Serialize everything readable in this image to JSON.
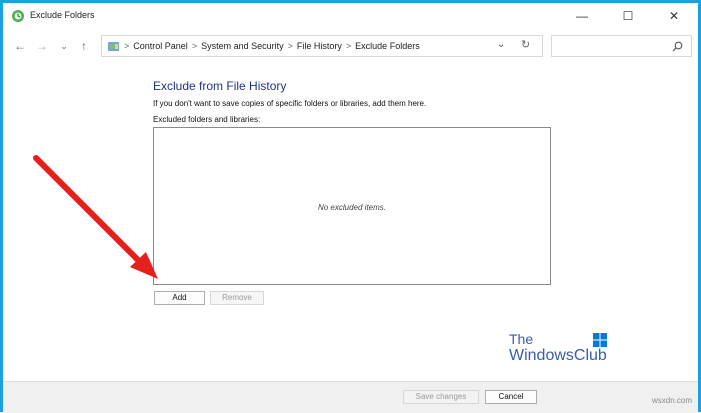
{
  "window": {
    "title": "Exclude Folders",
    "minimize_glyph": "—",
    "maximize_glyph": "☐",
    "close_glyph": "✕"
  },
  "nav": {
    "back_glyph": "←",
    "forward_glyph": "→",
    "recent_glyph": "⌄",
    "up_glyph": "↑",
    "breadcrumb_sep": ">",
    "breadcrumbs": [
      "Control Panel",
      "System and Security",
      "File History",
      "Exclude Folders"
    ],
    "dropdown_glyph": "⌄",
    "refresh_glyph": "↻",
    "search_placeholder": ""
  },
  "main": {
    "heading": "Exclude from File History",
    "description": "If you don't want to save copies of specific folders or libraries, add them here.",
    "list_label": "Excluded folders and libraries:",
    "empty_text": "No excluded items.",
    "add_label": "Add",
    "remove_label": "Remove"
  },
  "footer": {
    "save_label": "Save changes",
    "cancel_label": "Cancel"
  },
  "branding": {
    "logo_line1": "The",
    "logo_line2": "WindowsClub",
    "watermark": "wsxdn.com"
  },
  "colors": {
    "frame_border": "#1ba1e2",
    "heading": "#1e3287",
    "arrow": "#e3201b",
    "logo_text": "#3a5da8",
    "win_logo": "#0a78d7"
  },
  "icons": {
    "app": "file-history-icon",
    "address": "control-panel-icon",
    "search": "search-icon",
    "arrow": "red-annotation-arrow"
  }
}
